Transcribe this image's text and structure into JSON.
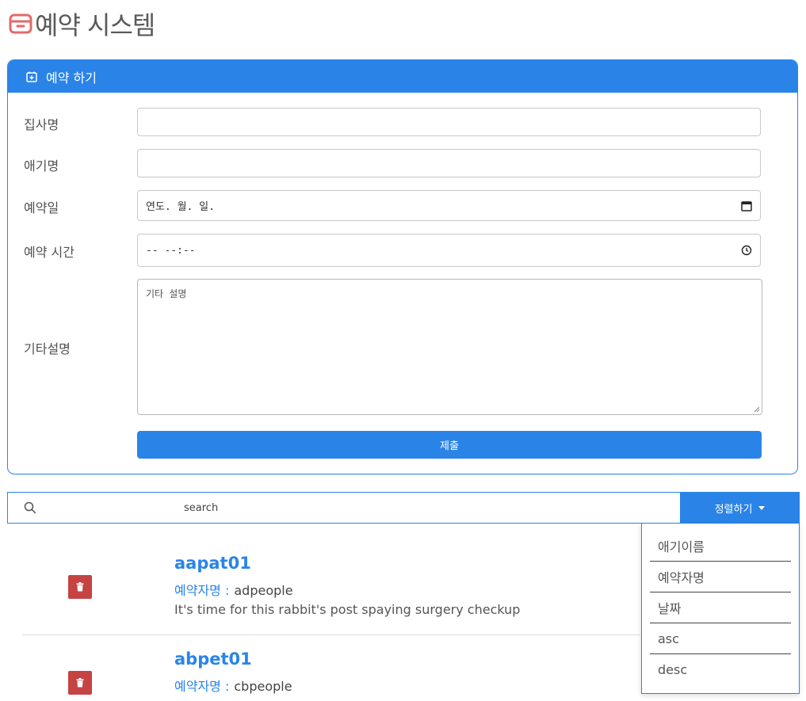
{
  "app": {
    "title": "예약 시스템"
  },
  "form": {
    "header": "예약 하기",
    "fields": {
      "owner_name": {
        "label": "집사명",
        "value": ""
      },
      "pet_name": {
        "label": "애기명",
        "value": ""
      },
      "date": {
        "label": "예약일",
        "value": "연도. 월. 일."
      },
      "time": {
        "label": "예약 시간",
        "value": "-- --:--"
      },
      "notes": {
        "label": "기타설명",
        "placeholder": "기타 설명"
      }
    },
    "submit_label": "제출"
  },
  "search": {
    "placeholder": "search"
  },
  "sort": {
    "label": "정렬하기",
    "options": [
      "애기이름",
      "예약자명",
      "날짜",
      "asc",
      "desc"
    ]
  },
  "appointments": [
    {
      "pet_name": "aapat01",
      "owner_label": "예약자명 :",
      "owner": "adpeople",
      "note": "It's time for this rabbit's post spaying surgery checkup"
    },
    {
      "pet_name": "abpet01",
      "owner_label": "예약자명 :",
      "owner": "cbpeople",
      "note": ""
    }
  ],
  "colors": {
    "accent": "#2a84e8",
    "danger": "#c64343",
    "logo": "#e26a6a"
  }
}
